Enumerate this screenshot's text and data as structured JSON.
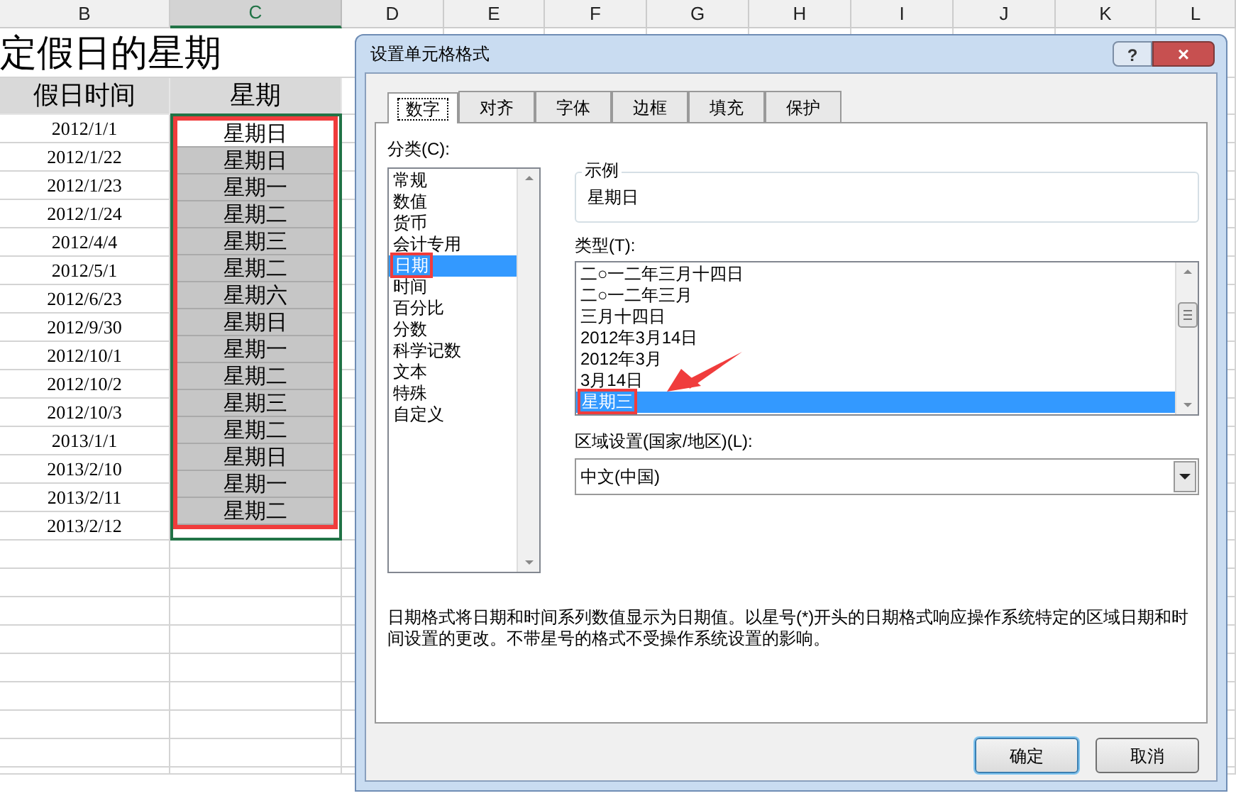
{
  "sheet": {
    "columns": [
      {
        "label": "B",
        "selected": false
      },
      {
        "label": "C",
        "selected": true
      },
      {
        "label": "D",
        "selected": false
      },
      {
        "label": "E",
        "selected": false
      },
      {
        "label": "F",
        "selected": false
      },
      {
        "label": "G",
        "selected": false
      },
      {
        "label": "H",
        "selected": false
      },
      {
        "label": "I",
        "selected": false
      },
      {
        "label": "J",
        "selected": false
      },
      {
        "label": "K",
        "selected": false
      },
      {
        "label": "L",
        "selected": false
      }
    ],
    "title": "定假日的星期",
    "header": [
      "假日时间",
      "星期"
    ],
    "rows": [
      {
        "date": "2012/1/1",
        "weekday": "星期日",
        "active": true
      },
      {
        "date": "2012/1/22",
        "weekday": "星期日",
        "active": false
      },
      {
        "date": "2012/1/23",
        "weekday": "星期一",
        "active": false
      },
      {
        "date": "2012/1/24",
        "weekday": "星期二",
        "active": false
      },
      {
        "date": "2012/4/4",
        "weekday": "星期三",
        "active": false
      },
      {
        "date": "2012/5/1",
        "weekday": "星期二",
        "active": false
      },
      {
        "date": "2012/6/23",
        "weekday": "星期六",
        "active": false
      },
      {
        "date": "2012/9/30",
        "weekday": "星期日",
        "active": false
      },
      {
        "date": "2012/10/1",
        "weekday": "星期一",
        "active": false
      },
      {
        "date": "2012/10/2",
        "weekday": "星期二",
        "active": false
      },
      {
        "date": "2012/10/3",
        "weekday": "星期三",
        "active": false
      },
      {
        "date": "2013/1/1",
        "weekday": "星期二",
        "active": false
      },
      {
        "date": "2013/2/10",
        "weekday": "星期日",
        "active": false
      },
      {
        "date": "2013/2/11",
        "weekday": "星期一",
        "active": false
      },
      {
        "date": "2013/2/12",
        "weekday": "星期二",
        "active": false
      }
    ]
  },
  "dialog": {
    "title": "设置单元格格式",
    "help": "?",
    "close": "×",
    "tabs": [
      {
        "label": "数字",
        "selected": true
      },
      {
        "label": "对齐",
        "selected": false
      },
      {
        "label": "字体",
        "selected": false
      },
      {
        "label": "边框",
        "selected": false
      },
      {
        "label": "填充",
        "selected": false
      },
      {
        "label": "保护",
        "selected": false
      }
    ],
    "category_label": "分类(C):",
    "categories": [
      {
        "label": "常规",
        "selected": false
      },
      {
        "label": "数值",
        "selected": false
      },
      {
        "label": "货币",
        "selected": false
      },
      {
        "label": "会计专用",
        "selected": false
      },
      {
        "label": "日期",
        "selected": true
      },
      {
        "label": "时间",
        "selected": false
      },
      {
        "label": "百分比",
        "selected": false
      },
      {
        "label": "分数",
        "selected": false
      },
      {
        "label": "科学记数",
        "selected": false
      },
      {
        "label": "文本",
        "selected": false
      },
      {
        "label": "特殊",
        "selected": false
      },
      {
        "label": "自定义",
        "selected": false
      }
    ],
    "sample": {
      "label": "示例",
      "value": "星期日"
    },
    "type_label": "类型(T):",
    "types": [
      {
        "label": "二○一二年三月十四日",
        "selected": false
      },
      {
        "label": "二○一二年三月",
        "selected": false
      },
      {
        "label": "三月十四日",
        "selected": false
      },
      {
        "label": "2012年3月14日",
        "selected": false
      },
      {
        "label": "2012年3月",
        "selected": false
      },
      {
        "label": "3月14日",
        "selected": false
      },
      {
        "label": "星期三",
        "selected": true
      }
    ],
    "locale_label": "区域设置(国家/地区)(L):",
    "locale": "中文(中国)",
    "description": "日期格式将日期和时间系列数值显示为日期值。以星号(*)开头的日期格式响应操作系统特定的区域日期和时间设置的更改。不带星号的格式不受操作系统设置的影响。",
    "buttons": [
      {
        "label": "确定",
        "kind": "primary"
      },
      {
        "label": "取消",
        "kind": "default"
      }
    ]
  }
}
